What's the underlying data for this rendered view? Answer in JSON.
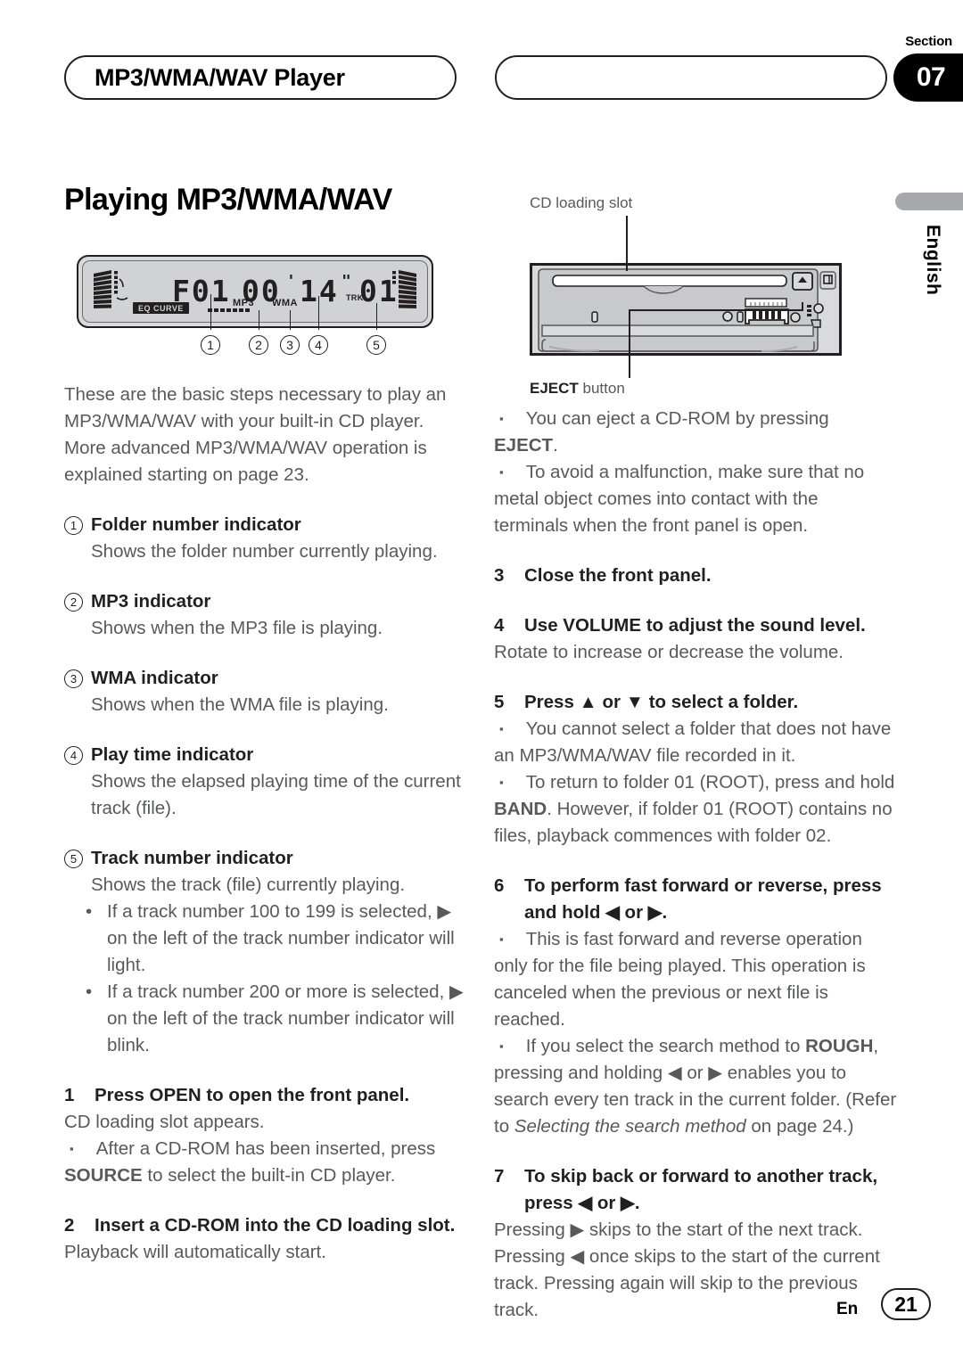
{
  "header": {
    "chapter_title": "MP3/WMA/WAV Player",
    "section_word": "Section",
    "section_number": "07"
  },
  "language_tab": {
    "label": "English"
  },
  "main_title": "Playing MP3/WMA/WAV",
  "lcd_display": {
    "folder": "F01",
    "minutes": "00",
    "apostrophe": "'",
    "seconds": "14",
    "quote": "\"",
    "track": "01",
    "eq_label": "EQ CURVE",
    "mp3_label": "MP3",
    "wma_label": "WMA",
    "trk_label": "TRK",
    "callouts": [
      "1",
      "2",
      "3",
      "4",
      "5"
    ]
  },
  "cd_figure": {
    "slot_label": "CD loading slot",
    "eject_label_bold": "EJECT",
    "eject_label_rest": " button"
  },
  "intro": "These are the basic steps necessary to play an MP3/WMA/WAV with your built-in CD player. More advanced MP3/WMA/WAV operation is explained starting on page 23.",
  "indicators": [
    {
      "num": "1",
      "title": "Folder number indicator",
      "body": "Shows the folder number currently playing."
    },
    {
      "num": "2",
      "title": "MP3 indicator",
      "body": "Shows when the MP3 file is playing."
    },
    {
      "num": "3",
      "title": "WMA indicator",
      "body": "Shows when the WMA file is playing."
    },
    {
      "num": "4",
      "title": "Play time indicator",
      "body": "Shows the elapsed playing time of the current track (file)."
    },
    {
      "num": "5",
      "title": "Track number indicator",
      "body": "Shows the track (file) currently playing.",
      "bullets": [
        "If a track number 100 to 199 is selected, ▶ on the left of the track number indicator will light.",
        "If a track number 200 or more is selected, ▶ on the left of the track number indicator will blink."
      ]
    }
  ],
  "steps": {
    "s1": {
      "num": "1",
      "title": "Press OPEN to open the front panel.",
      "body": "CD loading slot appears.",
      "note_pre": "After a CD-ROM has been inserted, press ",
      "note_bold": "SOURCE",
      "note_post": " to select the built-in CD player."
    },
    "s2": {
      "num": "2",
      "title": "Insert a CD-ROM into the CD loading slot.",
      "body": "Playback will automatically start."
    },
    "s3": {
      "num": "3",
      "title": "Close the front panel."
    },
    "s4": {
      "num": "4",
      "title": "Use VOLUME to adjust the sound level.",
      "body": "Rotate to increase or decrease the volume."
    },
    "s5": {
      "num": "5",
      "title": "Press ▲ or ▼ to select a folder.",
      "note1": "You cannot select a folder that does not have an MP3/WMA/WAV file recorded in it.",
      "note2_pre": "To return to folder 01 (ROOT), press and hold ",
      "note2_bold": "BAND",
      "note2_post": ". However, if folder 01 (ROOT) contains no files, playback commences with folder 02."
    },
    "s6": {
      "num": "6",
      "title": "To perform fast forward or reverse, press and hold ◀ or ▶.",
      "note1": "This is fast forward and reverse operation only for the file being played. This operation is canceled when the previous or next file is reached.",
      "note2_pre": "If you select the search method to ",
      "note2_bold": "ROUGH",
      "note2_mid": ", pressing and holding ◀ or ▶ enables you to search every ten track in the current folder. (Refer to ",
      "note2_italic": "Selecting the search method",
      "note2_post": " on page 24.)"
    },
    "s7": {
      "num": "7",
      "title": "To skip back or forward to another track, press ◀ or ▶.",
      "body": "Pressing ▶ skips to the start of the next track. Pressing ◀ once skips to the start of the current track. Pressing again will skip to the previous track."
    }
  },
  "footer": {
    "lang_code": "En",
    "page_number": "21"
  },
  "markers": {
    "square": "▪",
    "dot": "•"
  }
}
